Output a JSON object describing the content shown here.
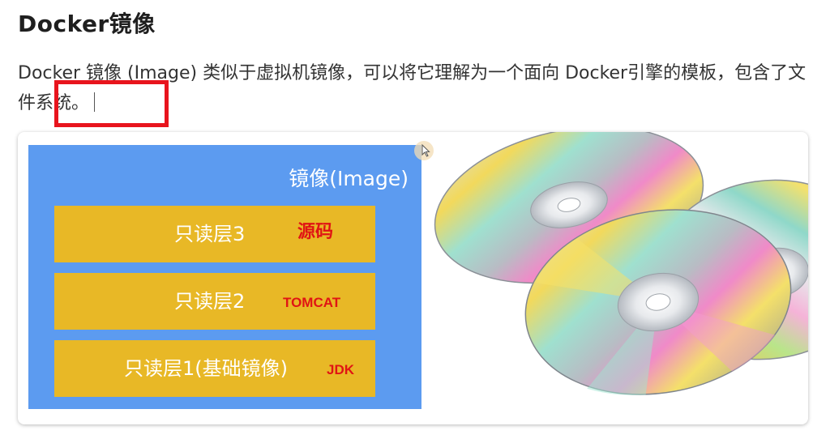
{
  "document": {
    "heading": "Docker镜像",
    "paragraph": "Docker 镜像 (Image) 类似于虚拟机镜像，可以将它理解为一个面向 Docker引擎的模板，包含了文件系统。"
  },
  "figure": {
    "image_title": "镜像(Image)",
    "layers": [
      {
        "label": "只读层3",
        "tag": "源码"
      },
      {
        "label": "只读层2",
        "tag": "TOMCAT"
      },
      {
        "label": "只读层1(基础镜像)",
        "tag": "JDK"
      }
    ],
    "icon": "cd-discs-illustration"
  },
  "colors": {
    "highlight": "#e8141d",
    "image_panel": "#5c9bf0",
    "layer": "#e8b826",
    "tag": "#e01414"
  }
}
